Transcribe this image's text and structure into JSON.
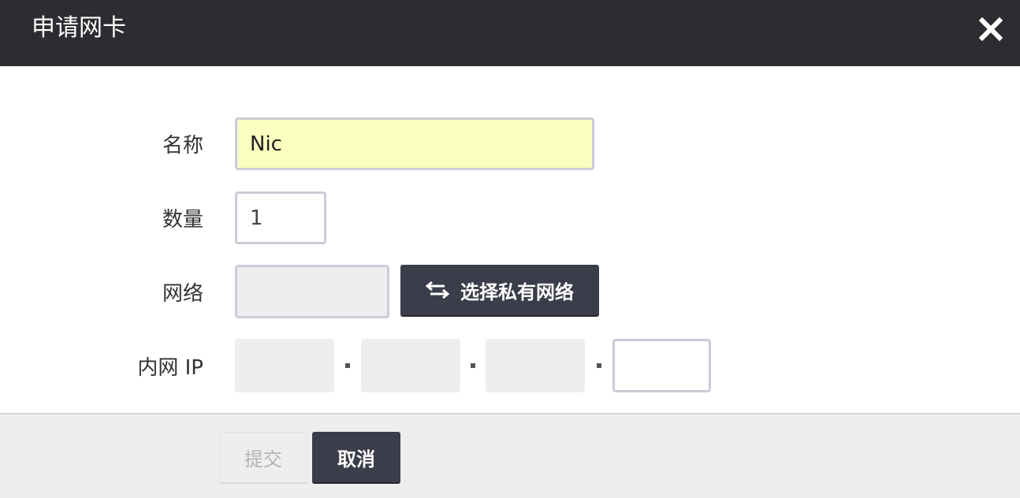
{
  "dialog": {
    "title": "申请网卡",
    "close_icon": "close-icon"
  },
  "form": {
    "name": {
      "label": "名称",
      "value": "Nic"
    },
    "quantity": {
      "label": "数量",
      "value": "1"
    },
    "network": {
      "label": "网络",
      "value": "",
      "select_button_label": "选择私有网络",
      "select_button_icon": "swap-arrows-icon"
    },
    "ip": {
      "label": "内网 IP",
      "segments": [
        "",
        "",
        "",
        ""
      ],
      "separator": "."
    }
  },
  "footer": {
    "submit_label": "提交",
    "cancel_label": "取消"
  },
  "colors": {
    "header_bg": "#2b2d30",
    "primary_button": "#3b3d4a",
    "autofill_bg": "#f9ffbf",
    "footer_bg": "#eeeeee"
  }
}
